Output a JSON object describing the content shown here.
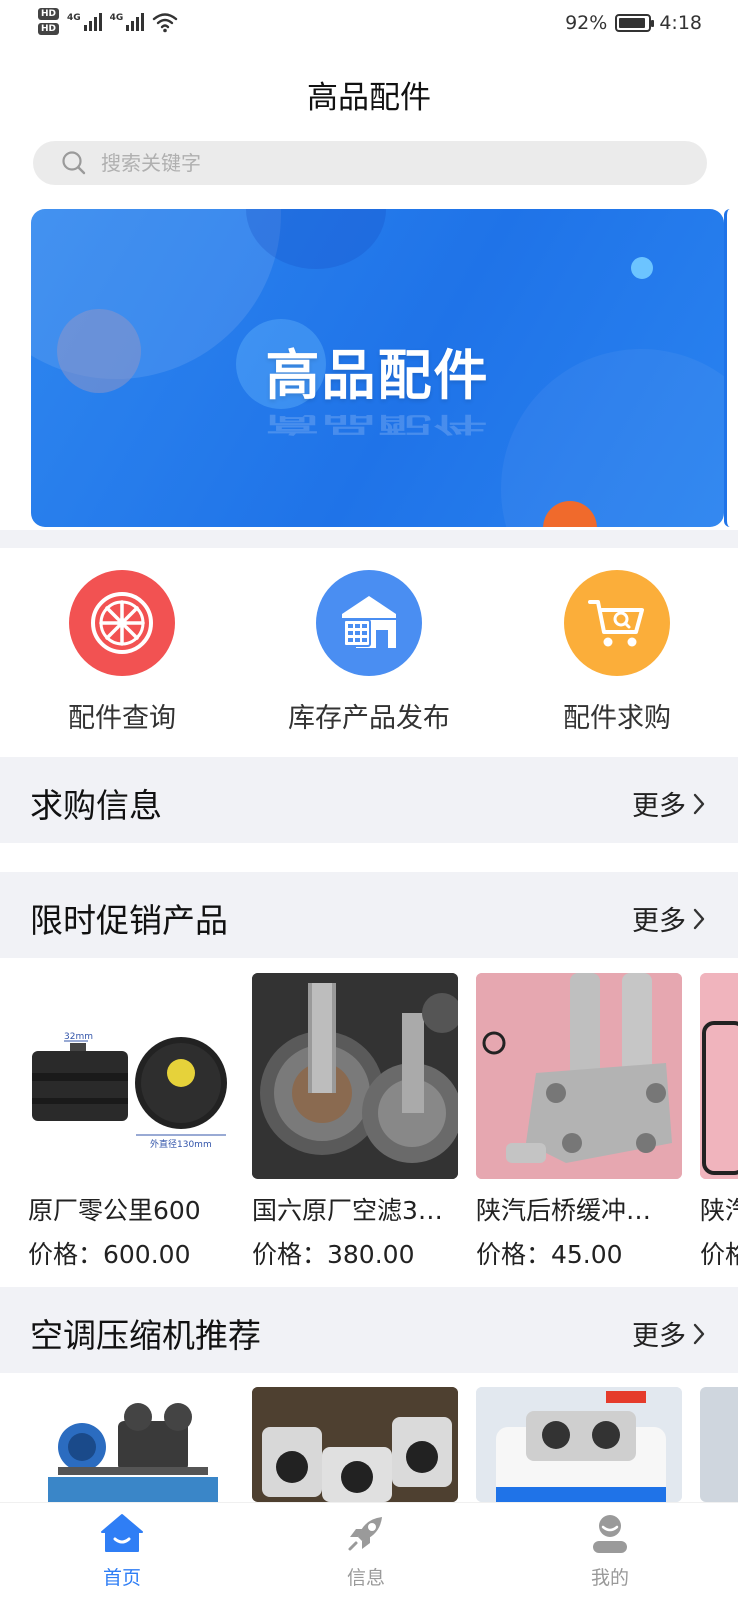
{
  "status_bar": {
    "hd1": "HD",
    "hd2": "HD",
    "net1": "4G",
    "net2": "4G",
    "battery_percent": "92%",
    "battery_level": 0.92,
    "time": "4:18"
  },
  "header": {
    "title": "高品配件"
  },
  "search": {
    "placeholder": "搜索关键字"
  },
  "banner": {
    "text": "高品配件"
  },
  "quick_nav": [
    {
      "label": "配件查询",
      "icon": "wheel-icon",
      "color": "#f25252"
    },
    {
      "label": "库存产品发布",
      "icon": "warehouse-icon",
      "color": "#4a8ef2"
    },
    {
      "label": "配件求购",
      "icon": "cart-icon",
      "color": "#fbae3a"
    }
  ],
  "sections": {
    "purchase_requests": {
      "title": "求购信息",
      "more": "更多"
    },
    "promotions": {
      "title": "限时促销产品",
      "more": "更多"
    },
    "compressors": {
      "title": "空调压缩机推荐",
      "more": "更多"
    }
  },
  "promo_products": [
    {
      "name": "原厂零公里600",
      "price": "价格：600.00",
      "img_dim_top": "32mm",
      "img_dim_bottom": "外直径130mm"
    },
    {
      "name": "国六原厂空滤3…",
      "price": "价格：380.00"
    },
    {
      "name": "陕汽后桥缓冲…",
      "price": "价格：45.00"
    },
    {
      "name": "陕汽",
      "price": "价格"
    }
  ],
  "tabbar": [
    {
      "label": "首页",
      "icon": "home-icon",
      "active": true,
      "color": "#2f7ef5"
    },
    {
      "label": "信息",
      "icon": "rocket-icon",
      "active": false,
      "color": "#9a9a9a"
    },
    {
      "label": "我的",
      "icon": "user-icon",
      "active": false,
      "color": "#9a9a9a"
    }
  ]
}
